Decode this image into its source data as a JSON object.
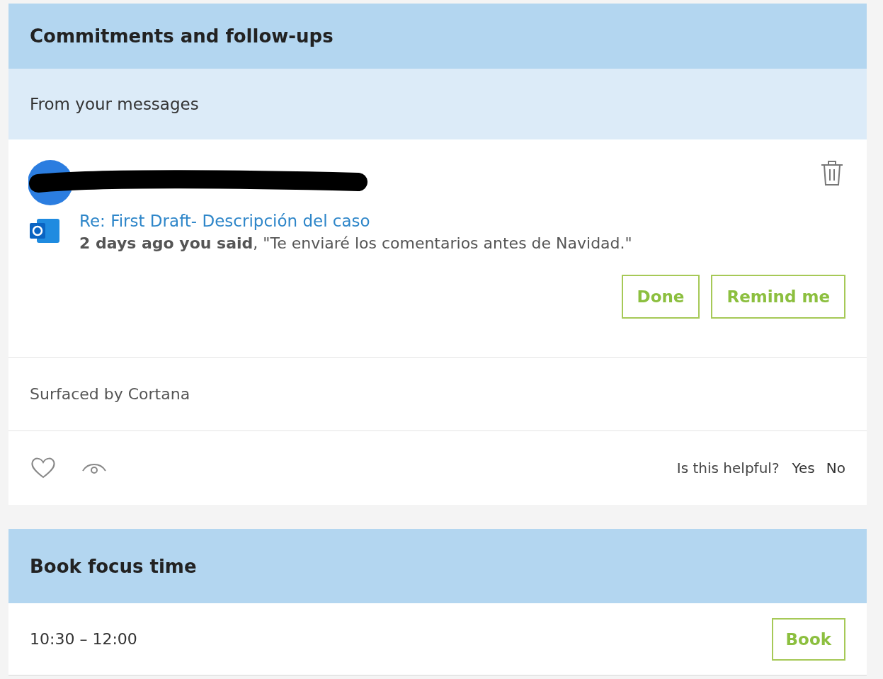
{
  "commitments": {
    "title": "Commitments and follow-ups",
    "subtitle": "From your messages",
    "item": {
      "subject": "Re: First Draft- Descripción del caso",
      "quote": "**2 days ago you said**, \"Te enviaré los comentarios antes de Navidad.\"",
      "buttons": [
        "Done",
        "Remind me"
      ]
    },
    "source": "Surfaced by Cortana",
    "feedback": {
      "question": "Is this helpful?",
      "answers": [
        "Yes",
        "No"
      ]
    }
  },
  "focus": {
    "title": "Book focus time",
    "slot": "10:30 – 12:00",
    "button": "Book"
  }
}
